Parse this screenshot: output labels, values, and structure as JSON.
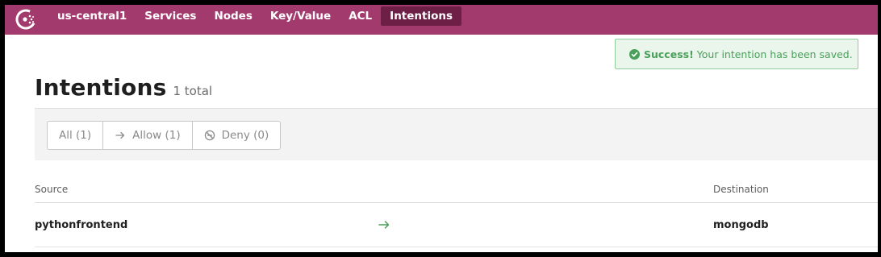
{
  "nav": {
    "logo_icon": "consul-logo",
    "items": [
      {
        "label": "us-central1",
        "active": false
      },
      {
        "label": "Services",
        "active": false
      },
      {
        "label": "Nodes",
        "active": false
      },
      {
        "label": "Key/Value",
        "active": false
      },
      {
        "label": "ACL",
        "active": false
      },
      {
        "label": "Intentions",
        "active": true
      }
    ],
    "colors": {
      "bar": "#a33a6d",
      "active": "#6e1f45"
    }
  },
  "toast": {
    "icon": "check-circle-icon",
    "title": "Success!",
    "message": "Your intention has been saved.",
    "color": "#4aa05a"
  },
  "header": {
    "title": "Intentions",
    "count": "1 total"
  },
  "filters": [
    {
      "label": "All (1)",
      "icon": null
    },
    {
      "label": "Allow (1)",
      "icon": "arrow-right-icon"
    },
    {
      "label": "Deny (0)",
      "icon": "deny-icon"
    }
  ],
  "table": {
    "columns": {
      "source": "Source",
      "destination": "Destination"
    },
    "rows": [
      {
        "source": "pythonfrontend",
        "action": "allow",
        "action_icon": "arrow-right-icon",
        "destination": "mongodb"
      }
    ],
    "allow_color": "#4aa05a"
  }
}
